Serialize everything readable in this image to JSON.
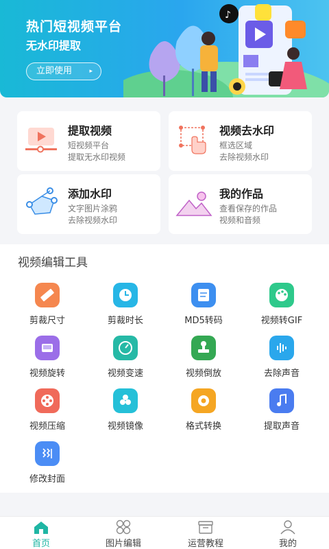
{
  "banner": {
    "title": "热门短视频平台",
    "subtitle": "无水印提取",
    "button_label": "立即使用",
    "button_arrow": "▸"
  },
  "features": [
    {
      "title": "提取视频",
      "line1": "短视频平台",
      "line2": "提取无水印视频",
      "icon": "extract-video-icon"
    },
    {
      "title": "视频去水印",
      "line1": "框选区域",
      "line2": "去除视频水印",
      "icon": "select-area-icon"
    },
    {
      "title": "添加水印",
      "line1": "文字图片涂鸦",
      "line2": "去除视频水印",
      "icon": "add-watermark-icon"
    },
    {
      "title": "我的作品",
      "line1": "查看保存的作品",
      "line2": "视频和音频",
      "icon": "my-works-icon"
    }
  ],
  "tools": {
    "title": "视频编辑工具",
    "items": [
      {
        "label": "剪裁尺寸",
        "icon": "ruler-icon",
        "color": "#f5874f"
      },
      {
        "label": "剪裁时长",
        "icon": "clock-icon",
        "color": "#27b6e6"
      },
      {
        "label": "MD5转码",
        "icon": "document-icon",
        "color": "#3d8ff0"
      },
      {
        "label": "视频转GIF",
        "icon": "palette-icon",
        "color": "#2ec98b"
      },
      {
        "label": "视频旋转",
        "icon": "rotate-icon",
        "color": "#9b6ee8"
      },
      {
        "label": "视频变速",
        "icon": "speedometer-icon",
        "color": "#26b9a6"
      },
      {
        "label": "视频倒放",
        "icon": "stamp-icon",
        "color": "#34a853"
      },
      {
        "label": "去除声音",
        "icon": "waveform-icon",
        "color": "#2aa7ec"
      },
      {
        "label": "视频压缩",
        "icon": "film-reel-icon",
        "color": "#f06a5a"
      },
      {
        "label": "视频镜像",
        "icon": "circles-icon",
        "color": "#25c0d8"
      },
      {
        "label": "格式转换",
        "icon": "gear-icon",
        "color": "#f5a623"
      },
      {
        "label": "提取声音",
        "icon": "music-note-icon",
        "color": "#4a7cf0"
      },
      {
        "label": "修改封面",
        "icon": "cover-icon",
        "color": "#4b8df5"
      }
    ]
  },
  "tabbar": {
    "items": [
      {
        "label": "首页",
        "icon": "home-icon",
        "active": true
      },
      {
        "label": "图片编辑",
        "icon": "grid-icon",
        "active": false
      },
      {
        "label": "运营教程",
        "icon": "box-icon",
        "active": false
      },
      {
        "label": "我的",
        "icon": "user-icon",
        "active": false
      }
    ],
    "active_color": "#1fb6a4"
  }
}
